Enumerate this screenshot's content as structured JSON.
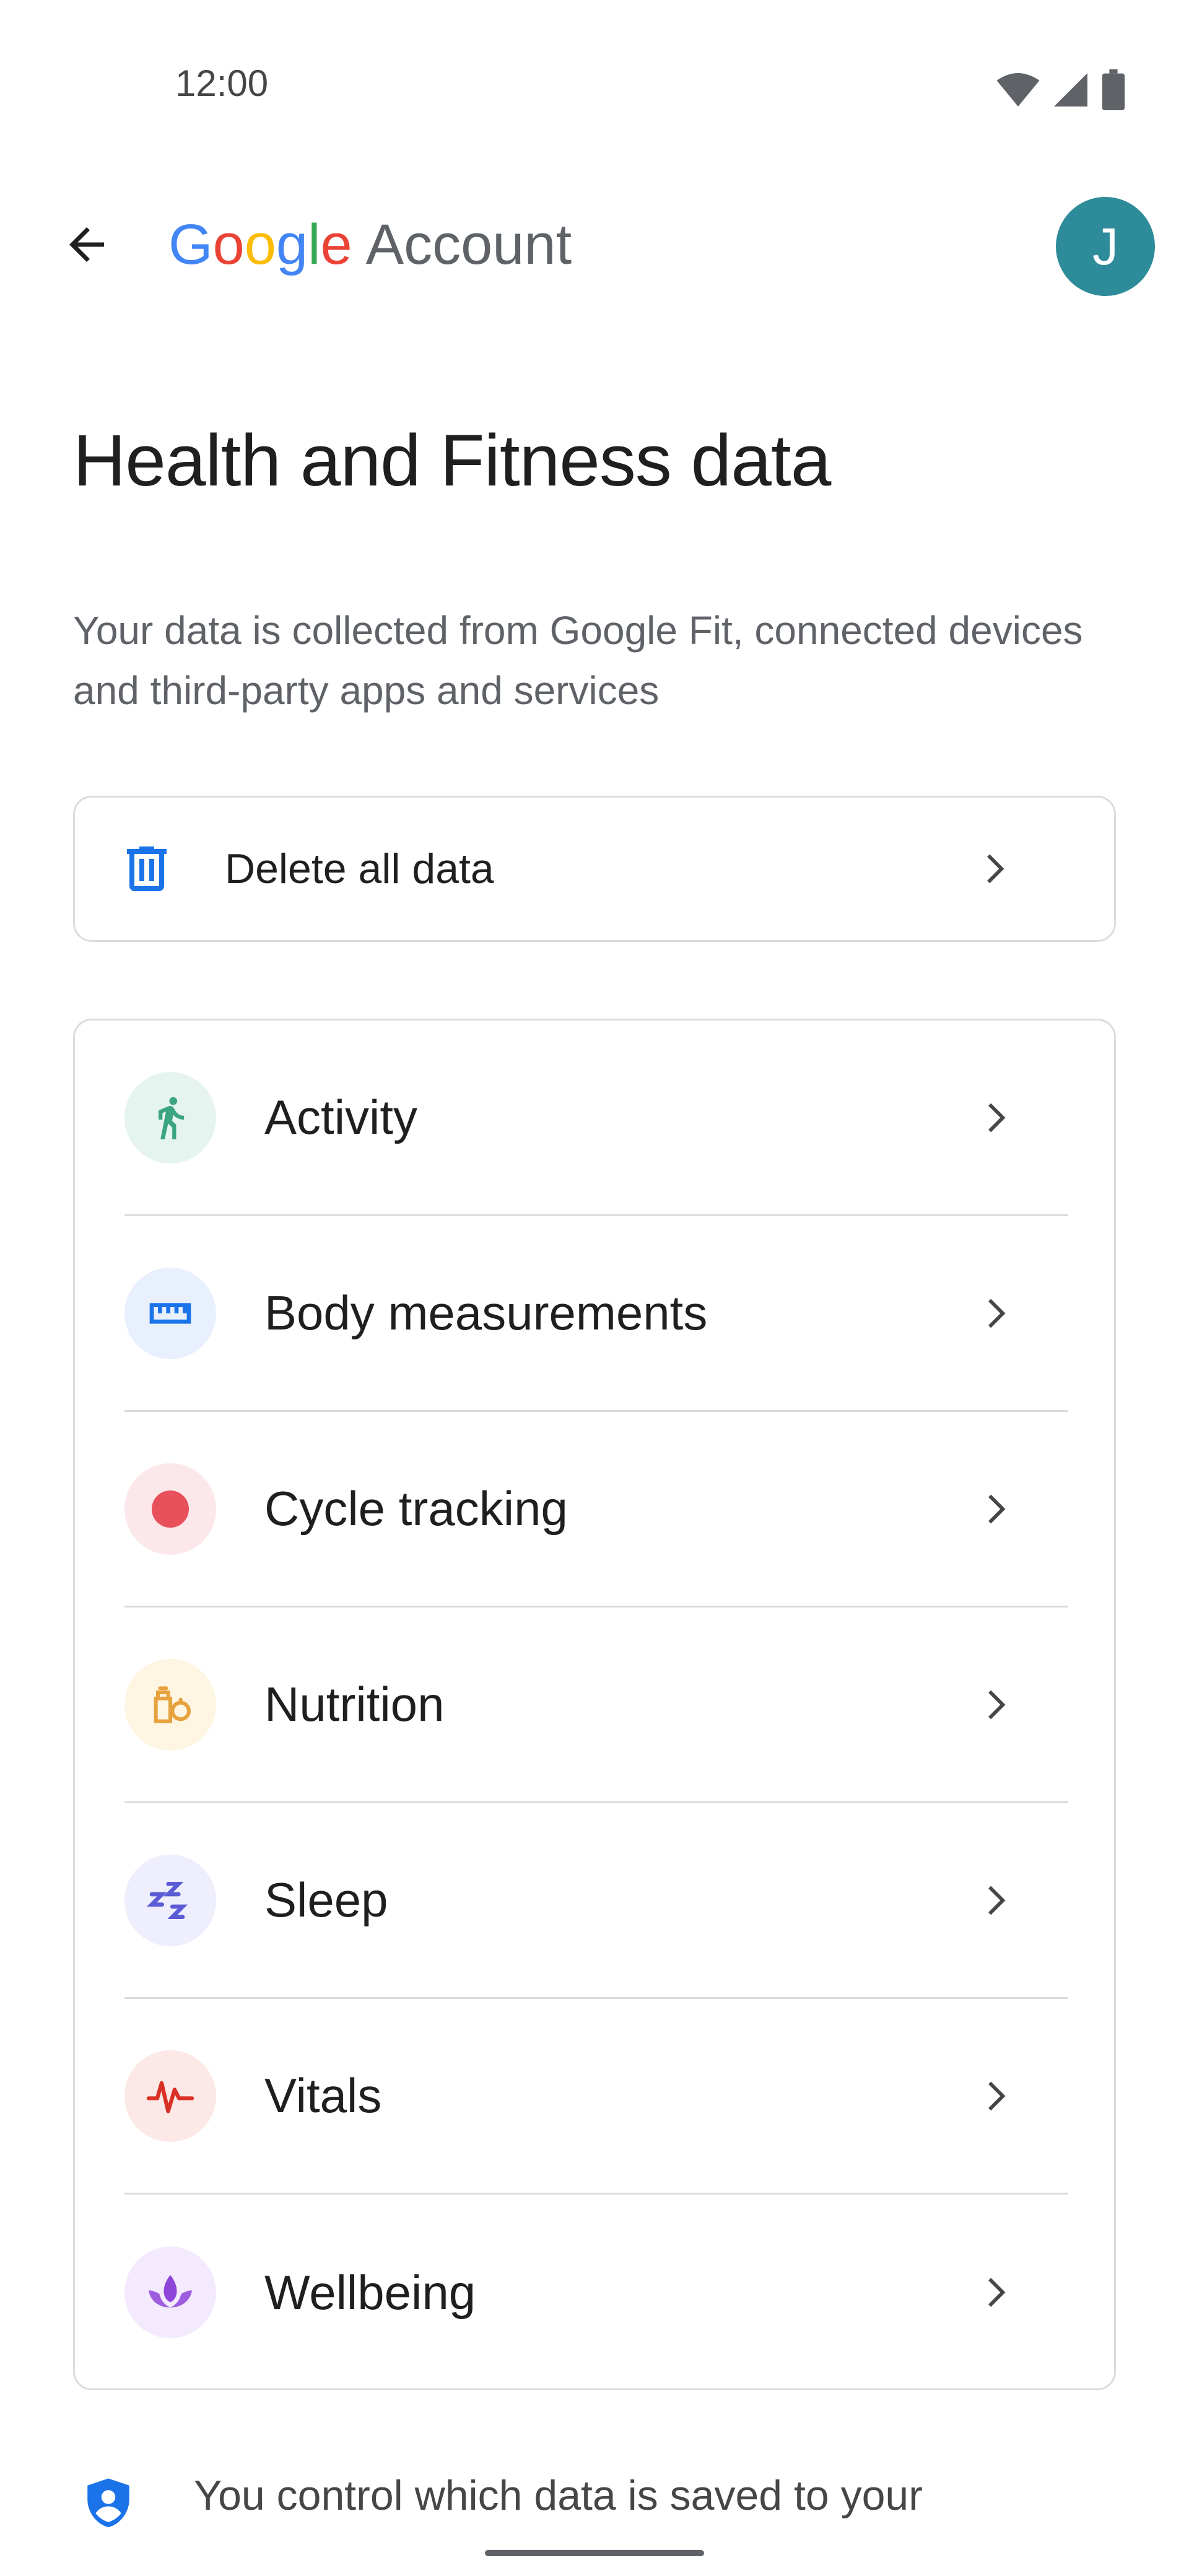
{
  "status_bar": {
    "time": "12:00",
    "icons": [
      "wifi-icon",
      "signal-icon",
      "battery-icon"
    ]
  },
  "app_bar": {
    "back_icon": "arrow-back-icon",
    "brand_google": "Google",
    "brand_account": "Account",
    "avatar_initial": "J",
    "colors": {
      "blue": "#4285F4",
      "red": "#EA4335",
      "yellow": "#FBBC05",
      "green": "#34A853",
      "avatar": "#2E8B9A"
    }
  },
  "page": {
    "title": "Health and Fitness data",
    "description": "Your data is collected from Google Fit, connected devices and third-party apps and services"
  },
  "delete_card": {
    "label": "Delete all data",
    "icon": "trash-icon",
    "accent": "#1A73E8"
  },
  "categories": [
    {
      "label": "Activity",
      "icon": "running-icon",
      "color": "#3AA57F",
      "bg": "#E6F4EF"
    },
    {
      "label": "Body measurements",
      "icon": "ruler-icon",
      "color": "#1A73E8",
      "bg": "#E8F0FE"
    },
    {
      "label": "Cycle tracking",
      "icon": "cycle-icon",
      "color": "#E8505B",
      "bg": "#FCE8EA"
    },
    {
      "label": "Nutrition",
      "icon": "nutrition-icon",
      "color": "#E6A23C",
      "bg": "#FEF5E2"
    },
    {
      "label": "Sleep",
      "icon": "sleep-icon",
      "color": "#5B5BD6",
      "bg": "#EEEEFC"
    },
    {
      "label": "Vitals",
      "icon": "pulse-icon",
      "color": "#D93025",
      "bg": "#FCE8E6"
    },
    {
      "label": "Wellbeing",
      "icon": "lotus-icon",
      "color": "#8E44D9",
      "bg": "#F3EAFD"
    }
  ],
  "footer": {
    "text": "You control which data is saved to your",
    "icon": "shield-person-icon"
  }
}
